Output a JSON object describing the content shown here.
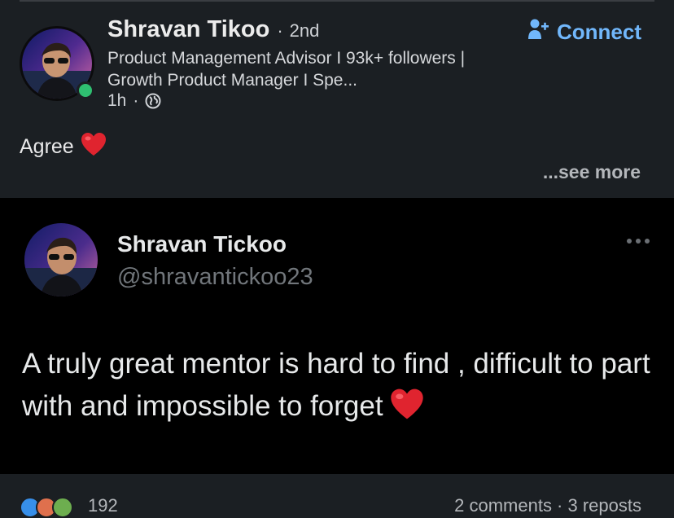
{
  "post": {
    "author_name": "Shravan Tikoo",
    "separator": "·",
    "degree": "2nd",
    "headline": "Product Management Advisor I 93k+ followers | Growth Product Manager I Spe...",
    "time": "1h",
    "meta_separator": "·",
    "visibility_icon": "globe-icon",
    "connect_label": "Connect",
    "connect_icon": "add-person-icon",
    "text": "Agree",
    "emoji": "heart-emoji",
    "see_more_label": "...see more",
    "online_status_color": "#2fbf71",
    "accent_color": "#71b7fb"
  },
  "embed": {
    "tweet_name": "Shravan Tickoo",
    "tweet_handle": "@shravantickoo23",
    "tweet_text": "A truly great mentor is hard to find , difficult to part with and impossible to forget",
    "tweet_emoji": "heart-emoji",
    "more_icon": "more-horizontal-icon"
  },
  "reactions": {
    "count": "192",
    "comments": "2 comments · 3 reposts"
  }
}
